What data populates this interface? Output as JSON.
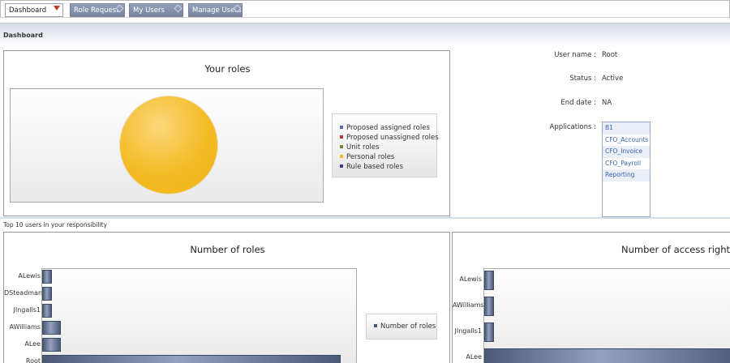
{
  "tabs": [
    {
      "label": "Dashboard",
      "active": true
    },
    {
      "label": "Role Request",
      "active": false
    },
    {
      "label": "My Users",
      "active": false
    },
    {
      "label": "Manage Users",
      "active": false
    }
  ],
  "header": {
    "title": "Dashboard"
  },
  "roles_panel": {
    "title": "Your roles",
    "pie_color": "#f4bb24",
    "legend": [
      {
        "label": "Proposed assigned roles",
        "color": "#4f6fae"
      },
      {
        "label": "Proposed unassigned roles",
        "color": "#b03a2e"
      },
      {
        "label": "Unit roles",
        "color": "#6a8a3a"
      },
      {
        "label": "Personal roles",
        "color": "#f4bb24"
      },
      {
        "label": "Rule based roles",
        "color": "#3b3b8f"
      }
    ]
  },
  "user_info": {
    "username_label": "User name",
    "username": "Root",
    "status_label": "Status",
    "status": "Active",
    "end_date_label": "End date",
    "end_date": "NA",
    "applications_label": "Applications",
    "separator": ":",
    "applications": [
      "B1",
      "CFO_Accounts",
      "CFO_Invoice",
      "CFO_Payroll",
      "Reporting"
    ]
  },
  "section_label": "Top 10 users in your responsibility",
  "roles_chart": {
    "title": "Number of roles",
    "legend_label": "Number of roles",
    "users": [
      "ALewis",
      "DSteadman",
      "JIngalls1",
      "AWilliams",
      "ALee",
      "Root"
    ],
    "values": [
      1,
      1,
      1,
      2,
      2,
      32
    ],
    "max": 32
  },
  "access_chart": {
    "title": "Number of access rights",
    "users": [
      "ALewis",
      "AWilliams",
      "JIngalls1",
      "ALee"
    ],
    "values": [
      1,
      1,
      1,
      36
    ],
    "max": 36
  },
  "colors": {
    "tab_inactive": "#78839f",
    "bar": "#4b5a76",
    "link": "#3a64b0"
  }
}
